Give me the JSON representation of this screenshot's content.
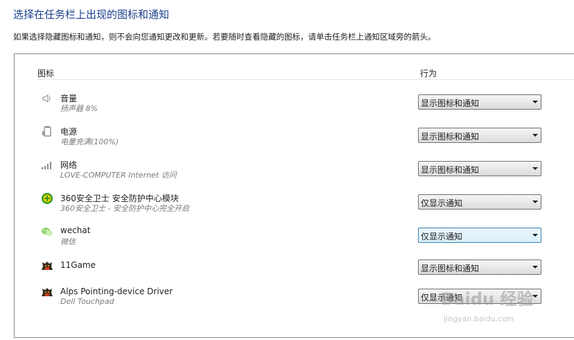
{
  "header": {
    "title": "选择在任务栏上出现的图标和通知",
    "description": "如果选择隐藏图标和通知，则不会向您通知更改和更新。若要随时查看隐藏的图标，请单击任务栏上通知区域旁的箭头。"
  },
  "table": {
    "columns": {
      "icon": "图标",
      "behavior": "行为"
    },
    "rows": [
      {
        "icon": "speaker-icon",
        "name": "音量",
        "sub": "扬声器 8%",
        "behavior": "显示图标和通知"
      },
      {
        "icon": "power-icon",
        "name": "电源",
        "sub": "电量充满(100%)",
        "behavior": "显示图标和通知"
      },
      {
        "icon": "network-signal-icon",
        "name": "网络",
        "sub": "LOVE-COMPUTER Internet 访问",
        "behavior": "显示图标和通知"
      },
      {
        "icon": "360-security-icon",
        "name": "360安全卫士 安全防护中心模块",
        "sub": "360安全卫士 - 安全防护中心完全开启",
        "behavior": "仅显示通知"
      },
      {
        "icon": "wechat-icon",
        "name": "wechat",
        "sub": "微信",
        "behavior": "仅显示通知"
      },
      {
        "icon": "11game-icon",
        "name": "11Game",
        "sub": "",
        "behavior": "显示图标和通知"
      },
      {
        "icon": "alps-pointing-icon",
        "name": "Alps Pointing-device Driver",
        "sub": "Dell Touchpad",
        "behavior": "仅显示通知"
      }
    ]
  },
  "watermark": {
    "text": "Baidu 经验",
    "url": "jingyan.baidu.com"
  }
}
